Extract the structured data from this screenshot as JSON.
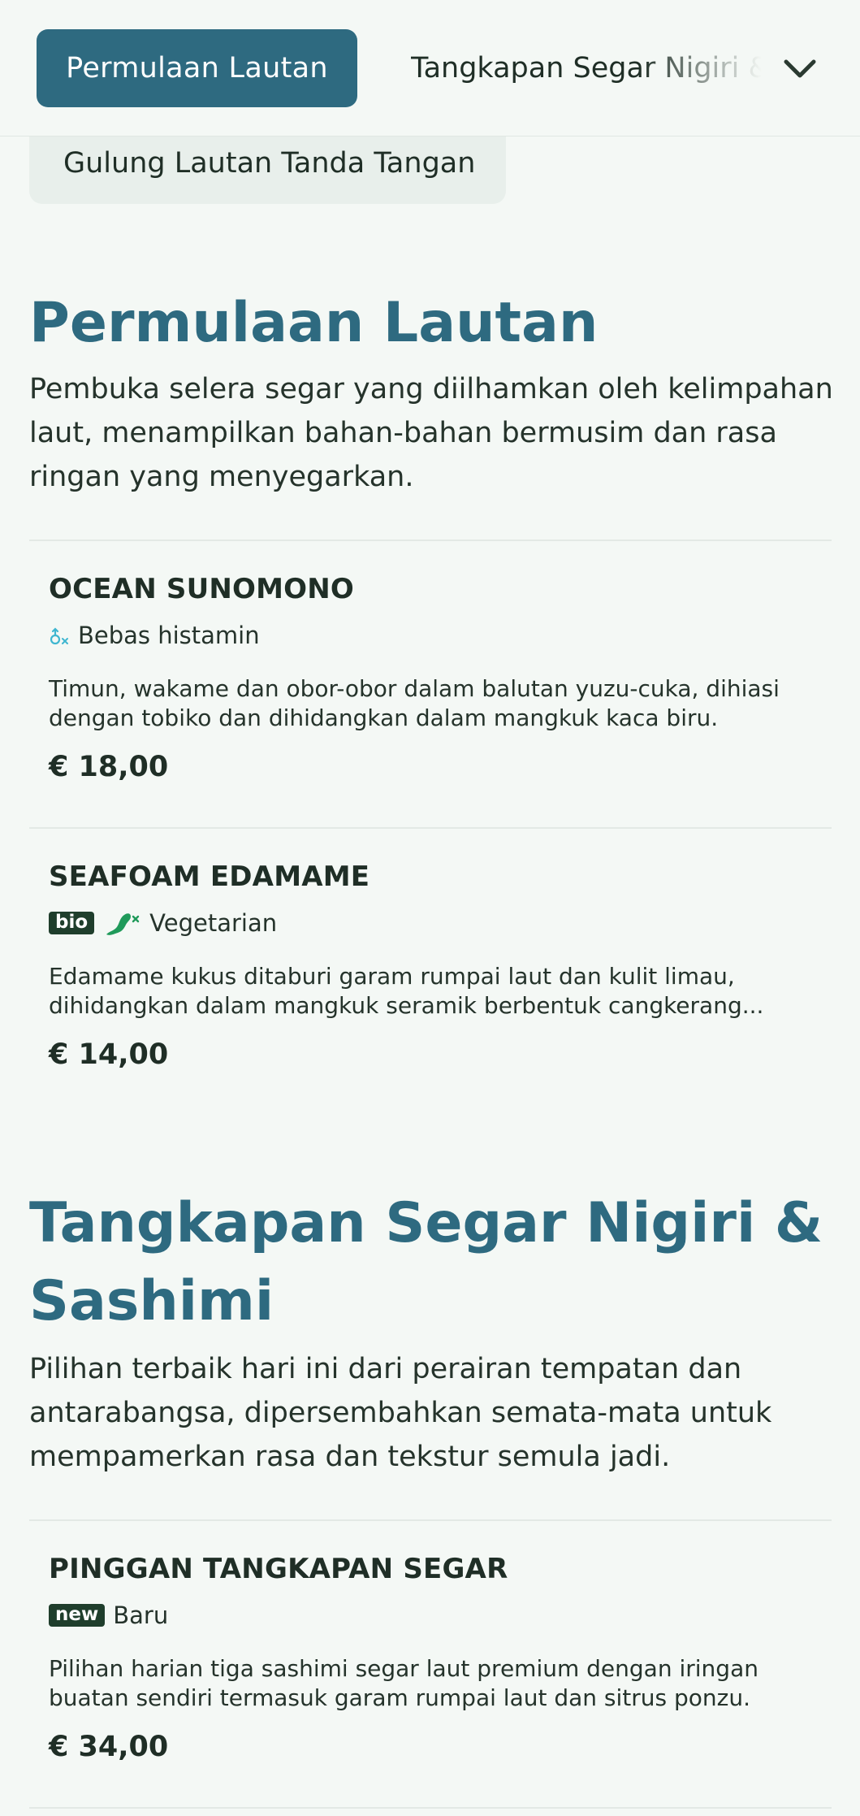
{
  "nav": {
    "active_tab": "Permulaan Lautan",
    "next_tab": "Tangkapan Segar Nigiri & Sashimi",
    "peek_chip": "Gulung Lautan Tanda Tangan"
  },
  "colors": {
    "accent": "#2e6a80",
    "background": "#f4f8f5",
    "text": "#1f2e26",
    "badge_bg": "#1f3e2c",
    "histamine_icon": "#3fb6d0",
    "vegetarian_icon": "#1f9a5a"
  },
  "sections": [
    {
      "title": "Permulaan Lautan",
      "description": "Pembuka selera segar yang diilhamkan oleh kelimpahan laut, menampilkan bahan-bahan bermusim dan rasa ringan yang menyegarkan.",
      "items": [
        {
          "name": "OCEAN SUNOMONO",
          "tag_icon": "histamine-free-icon",
          "tag_label": "Bebas histamin",
          "description": "Timun, wakame dan obor-obor dalam balutan yuzu-cuka, dihiasi dengan tobiko dan dihidangkan dalam mangkuk kaca biru.",
          "price": "€ 18,00"
        },
        {
          "name": "SEAFOAM EDAMAME",
          "badge": "bio",
          "tag_icon": "vegetarian-icon",
          "tag_label": "Vegetarian",
          "description": "Edamame kukus ditaburi garam rumpai laut dan kulit limau, dihidangkan dalam mangkuk seramik berbentuk cangkerang...",
          "price": "€ 14,00"
        }
      ]
    },
    {
      "title": "Tangkapan Segar Nigiri & Sashimi",
      "description": "Pilihan terbaik hari ini dari perairan tempatan dan antarabangsa, dipersembahkan semata-mata untuk mempamerkan rasa dan tekstur semula jadi.",
      "items": [
        {
          "name": "PINGGAN TANGKAPAN SEGAR",
          "badge": "new",
          "tag_label": "Baru",
          "description": "Pilihan harian tiga sashimi segar laut premium dengan iringan buatan sendiri termasuk garam rumpai laut dan sitrus ponzu.",
          "price": "€ 34,00"
        }
      ]
    }
  ]
}
